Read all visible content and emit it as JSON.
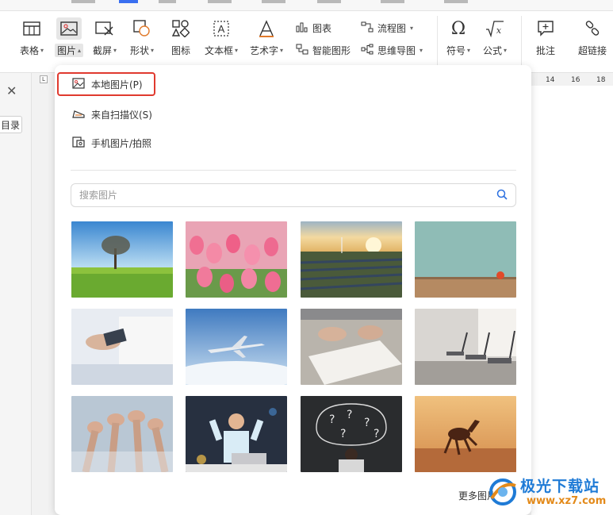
{
  "ribbon": {
    "items": [
      {
        "label": "表格",
        "icon": "table-icon"
      },
      {
        "label": "图片",
        "icon": "picture-icon"
      },
      {
        "label": "截屏",
        "icon": "screenshot-icon"
      },
      {
        "label": "形状",
        "icon": "shape-icon"
      },
      {
        "label": "图标",
        "icon": "icons-icon"
      },
      {
        "label": "文本框",
        "icon": "textbox-icon"
      },
      {
        "label": "艺术字",
        "icon": "wordart-icon"
      },
      {
        "label": "符号",
        "icon": "omega-icon"
      },
      {
        "label": "公式",
        "icon": "formula-icon"
      },
      {
        "label": "批注",
        "icon": "comment-icon"
      },
      {
        "label": "超链接",
        "icon": "link-icon"
      }
    ],
    "small": {
      "chart": "图表",
      "smartart": "智能图形",
      "flowchart": "流程图",
      "mindmap": "思维导图"
    }
  },
  "left": {
    "toc_label": "目录"
  },
  "ruler": [
    "14",
    "16",
    "18"
  ],
  "dropdown": {
    "menu": [
      {
        "label": "本地图片(P)",
        "icon": "image-file-icon"
      },
      {
        "label": "来自扫描仪(S)",
        "icon": "scanner-icon"
      },
      {
        "label": "手机图片/拍照",
        "icon": "phone-photo-icon"
      }
    ],
    "search_placeholder": "搜索图片",
    "more_label": "更多图片"
  },
  "watermark": {
    "title": "极光下载站",
    "url": "www.xz7.com"
  }
}
